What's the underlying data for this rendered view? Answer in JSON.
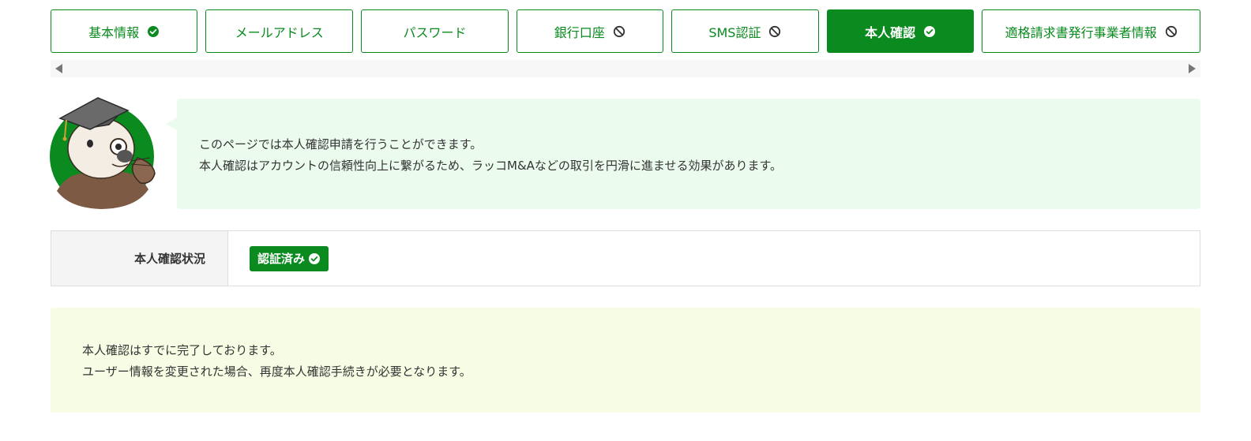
{
  "tabs": [
    {
      "label": "基本情報",
      "icon": "check-circle-icon",
      "active": false
    },
    {
      "label": "メールアドレス",
      "icon": "",
      "active": false
    },
    {
      "label": "パスワード",
      "icon": "",
      "active": false
    },
    {
      "label": "銀行口座",
      "icon": "prohibited-icon",
      "active": false
    },
    {
      "label": "SMS認証",
      "icon": "prohibited-icon",
      "active": false
    },
    {
      "label": "本人確認",
      "icon": "check-circle-icon",
      "active": true
    },
    {
      "label": "適格請求書発行事業者情報",
      "icon": "prohibited-icon",
      "active": false
    }
  ],
  "intro": {
    "mascot": "sea-otter-graduate-mascot",
    "line1": "このページでは本人確認申請を行うことができます。",
    "line2": "本人確認はアカウントの信頼性向上に繋がるため、ラッコM&Aなどの取引を円滑に進ませる効果があります。"
  },
  "status": {
    "label": "本人確認状況",
    "badge": "認証済み",
    "badge_icon": "check-circle-icon"
  },
  "notice": {
    "line1": "本人確認はすでに完了しております。",
    "line2": "ユーザー情報を変更された場合、再度本人確認手続きが必要となります。"
  },
  "colors": {
    "brand_green": "#0a8a1f",
    "bubble_bg": "#ebfbee",
    "notice_bg": "#f6fde4"
  }
}
